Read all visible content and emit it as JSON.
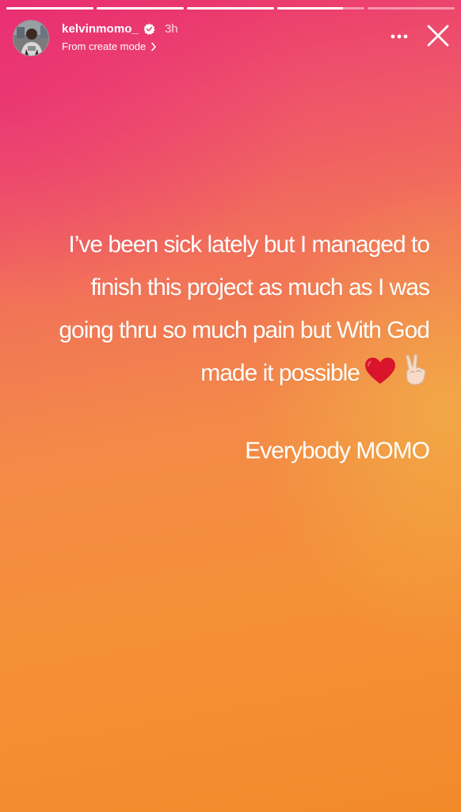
{
  "progress": {
    "segments": [
      1,
      1,
      1,
      0.75,
      0
    ]
  },
  "header": {
    "username": "kelvinmomo_",
    "time": "3h",
    "subtitle": "From create mode"
  },
  "story": {
    "lines": [
      "I’ve been sick lately but I managed to",
      "finish this project as much as I was",
      "going thru so much pain but With God",
      "made it possible"
    ],
    "signoff": "Everybody MOMO"
  },
  "icons": {
    "verified": "verified-badge-icon",
    "chevron": "chevron-right-icon",
    "more": "more-options-icon",
    "close": "close-icon",
    "heart": "red-heart-emoji",
    "peace": "victory-hand-emoji"
  }
}
